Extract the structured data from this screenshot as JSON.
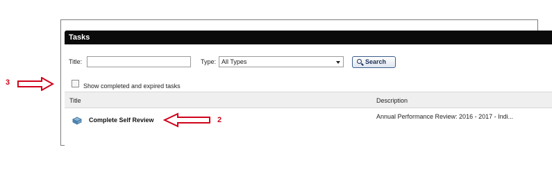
{
  "tasks_panel": {
    "header_title": "Tasks",
    "filters": {
      "title_label": "Title:",
      "title_value": "",
      "type_label": "Type:",
      "type_selected": "All Types",
      "search_label": "Search",
      "show_completed_label": "Show completed and expired tasks",
      "show_completed_checked": false
    },
    "table": {
      "columns": [
        "Title",
        "Description"
      ],
      "rows": [
        {
          "title": "Complete Self Review",
          "description": "Annual Performance Review: 2016 - 2017 - Indi..."
        }
      ]
    }
  },
  "annotations": {
    "arrow_checkbox_number": "3",
    "arrow_task_number": "2",
    "arrow_color": "#d0021b"
  }
}
